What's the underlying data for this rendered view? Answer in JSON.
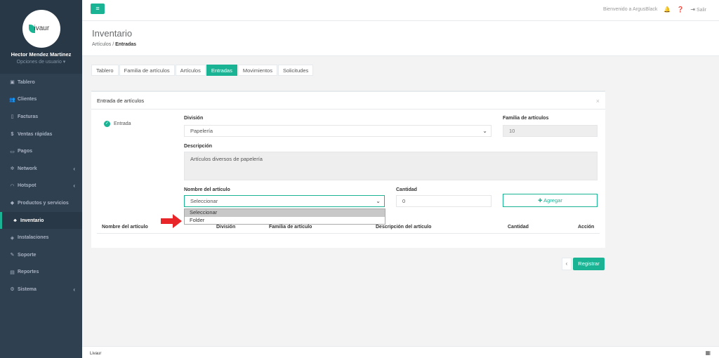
{
  "profile": {
    "logo_text": "ivaur",
    "name": "Hector Mendez Martinez",
    "options": "Opciones de usuario ▾"
  },
  "nav": [
    {
      "label": "Tablero",
      "icon": "dashboard-icon",
      "glyph": "▣",
      "chevron": false
    },
    {
      "label": "Clientes",
      "icon": "users-icon",
      "glyph": "👥",
      "chevron": false
    },
    {
      "label": "Facturas",
      "icon": "file-icon",
      "glyph": "▯",
      "chevron": false
    },
    {
      "label": "Ventas rápidas",
      "icon": "dollar-icon",
      "glyph": "$",
      "chevron": false
    },
    {
      "label": "Pagos",
      "icon": "money-icon",
      "glyph": "▭",
      "chevron": false
    },
    {
      "label": "Network",
      "icon": "network-icon",
      "glyph": "✲",
      "chevron": true
    },
    {
      "label": "Hotspot",
      "icon": "wifi-icon",
      "glyph": "◠",
      "chevron": true
    },
    {
      "label": "Productos y servicios",
      "icon": "tag-icon",
      "glyph": "◆",
      "chevron": false
    },
    {
      "label": "Inventario",
      "icon": "cubes-icon",
      "glyph": "♣",
      "chevron": false,
      "active": true
    },
    {
      "label": "Instalaciones",
      "icon": "plug-icon",
      "glyph": "◈",
      "chevron": false
    },
    {
      "label": "Soporte",
      "icon": "wrench-icon",
      "glyph": "✎",
      "chevron": false
    },
    {
      "label": "Reportes",
      "icon": "book-icon",
      "glyph": "▤",
      "chevron": false
    },
    {
      "label": "Sistema",
      "icon": "gears-icon",
      "glyph": "⚙",
      "chevron": true
    }
  ],
  "topbar": {
    "welcome": "Bienvenido a ArgusBlack",
    "logout": "Salir"
  },
  "heading": {
    "title": "Inventario",
    "crumb_parent": "Artículos",
    "crumb_sep": "/",
    "crumb_current": "Entradas"
  },
  "tabs": [
    {
      "label": "Tablero"
    },
    {
      "label": "Familia de artículos"
    },
    {
      "label": "Artículos"
    },
    {
      "label": "Entradas",
      "active": true
    },
    {
      "label": "Movimientos"
    },
    {
      "label": "Solicitudes"
    }
  ],
  "panel": {
    "title": "Entrada de artículos",
    "close": "×",
    "radio_label": "Entrada",
    "division_label": "División",
    "division_value": "Papelería",
    "family_label": "Familia de artículos",
    "family_value": "10",
    "desc_label": "Descripción",
    "desc_value": "Artículos diversos de papelería",
    "article_label": "Nombre del artículo",
    "article_value": "Seleccionar",
    "qty_label": "Cantidad",
    "qty_value": "0",
    "add_label": "Agregar",
    "dropdown_options": [
      "Seleccionar",
      "Folder"
    ]
  },
  "table": {
    "headers": [
      "Nombre del artículo",
      "División",
      "Familia de artículo",
      "Descripción del artículo",
      "Cantidad",
      "Acción"
    ]
  },
  "actions": {
    "back": "‹",
    "register": "Registrar"
  },
  "footer": {
    "text": "Livaur"
  }
}
